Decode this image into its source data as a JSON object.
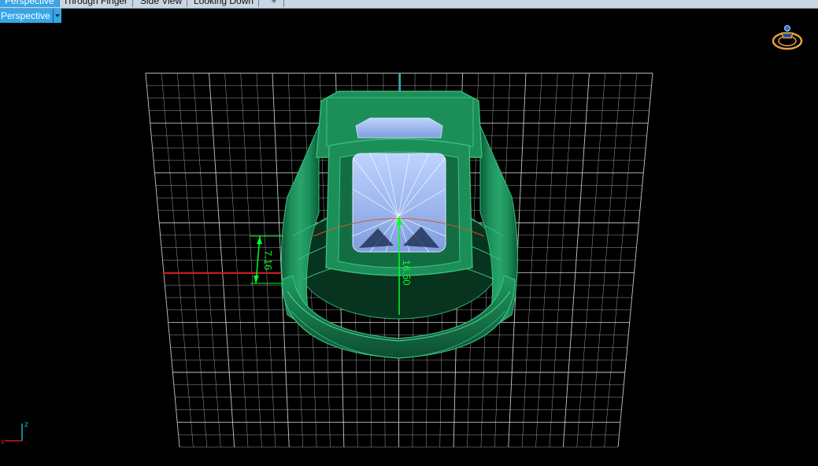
{
  "tabs": [
    {
      "label": "Perspective",
      "active": true
    },
    {
      "label": "Through Finger",
      "active": false
    },
    {
      "label": "Side View",
      "active": false
    },
    {
      "label": "Looking Down",
      "active": false
    }
  ],
  "tab_add_label": "+",
  "view_selector": {
    "label": "Perspective"
  },
  "dimensions": {
    "left_dimension": "7.16",
    "center_dimension": "16.50"
  },
  "axis": {
    "x_label": "x",
    "z_label": "z"
  },
  "colors": {
    "background": "#000000",
    "grid": "#cfcfcf",
    "ring_metal": "#1a8a55",
    "gem": "#8fb0ee",
    "dimension": "#00ff22",
    "x_axis": "#cc1b1b",
    "z_axis": "#17b6c9",
    "accent": "#37a6e8",
    "ring_icon": "#e8a040"
  },
  "icons": {
    "ring_icon": "ring-icon",
    "axis_gizmo": "axis-gizmo-icon"
  }
}
